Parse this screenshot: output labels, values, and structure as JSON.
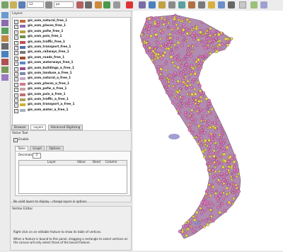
{
  "toolbar": {
    "scale_value": "12",
    "unit_value": "px",
    "icons": [
      "hand-icon",
      "pan-icon",
      "zoom-in-icon",
      "zoom-out-icon",
      "zoom-full-icon",
      "identify-icon",
      "select-icon",
      "measure-icon",
      "ruler-icon",
      "label-icon",
      "text-icon",
      "settings-icon",
      "globe-icon",
      "add-feature-icon",
      "crosshair-icon",
      "grid-icon",
      "node-icon",
      "layout-icon",
      "report-icon",
      "map-tip-icon",
      "bookmark-icon",
      "search-icon",
      "label-style-icon"
    ]
  },
  "layers_panel": {
    "title": "Layers",
    "layers": [
      {
        "name": "gis_osm_natural_free_1",
        "color": "#c06a3a"
      },
      {
        "name": "gis_osm_places_free_1",
        "color": "#8c6bb2"
      },
      {
        "name": "gis_osm_pofw_free_1",
        "color": "#b8a040"
      },
      {
        "name": "gis_osm_pois_free_1",
        "color": "#6a8f4a"
      },
      {
        "name": "gis_osm_traffic_free_1",
        "color": "#c05050"
      },
      {
        "name": "gis_osm_transport_free_1",
        "color": "#4a74b0"
      },
      {
        "name": "gis_osm_railways_free_1",
        "color": "#777777"
      },
      {
        "name": "gis_osm_roads_free_1",
        "color": "#a05030"
      },
      {
        "name": "gis_osm_waterways_free_1",
        "color": "#5f86c9"
      },
      {
        "name": "gis_osm_buildings_a_free_1",
        "color": "#9b4f8f"
      },
      {
        "name": "gis_osm_landuse_a_free_1",
        "color": "#7c89a8"
      },
      {
        "name": "gis_osm_natural_a_free_1",
        "color": "#c6a7c6"
      },
      {
        "name": "gis_osm_places_a_free_1",
        "color": "#d27a8f"
      },
      {
        "name": "gis_osm_pofw_a_free_1",
        "color": "#c9a0a6"
      },
      {
        "name": "gis_osm_pois_a_free_1",
        "color": "#bf7070"
      },
      {
        "name": "gis_osm_traffic_a_free_1",
        "color": "#b0a060"
      },
      {
        "name": "gis_osm_transport_a_free_1",
        "color": "#d0b030"
      },
      {
        "name": "gis_osm_water_a_free_1",
        "color": "#a6b0c2"
      }
    ]
  },
  "bottom_tabs": [
    "Browser",
    "Layers",
    "Advanced Digitizing"
  ],
  "value_tool": {
    "title": "Value Tool",
    "enable_label": "Enable",
    "tabs": [
      "Table",
      "Graph",
      "Options"
    ],
    "decimals_label": "Decimals",
    "decimals_value": "2",
    "columns": [
      "Layer",
      "Value",
      "Band",
      "Column"
    ],
    "status": "No valid layers to display - change layers in options"
  },
  "vertex_editor": {
    "title": "Vertex Editor",
    "hint_1": "Right click on an editable feature to show its table of vertices.",
    "hint_2": "When a feature is bound to this panel, dragging a rectangle to select vertices on the canvas will only select those of the bound feature."
  },
  "colors": {
    "dot_pink": "#e07ac0",
    "dot_yellow": "#e8d84a",
    "dot_outline": "#5a3a4a",
    "map_background": "#ffffff"
  }
}
